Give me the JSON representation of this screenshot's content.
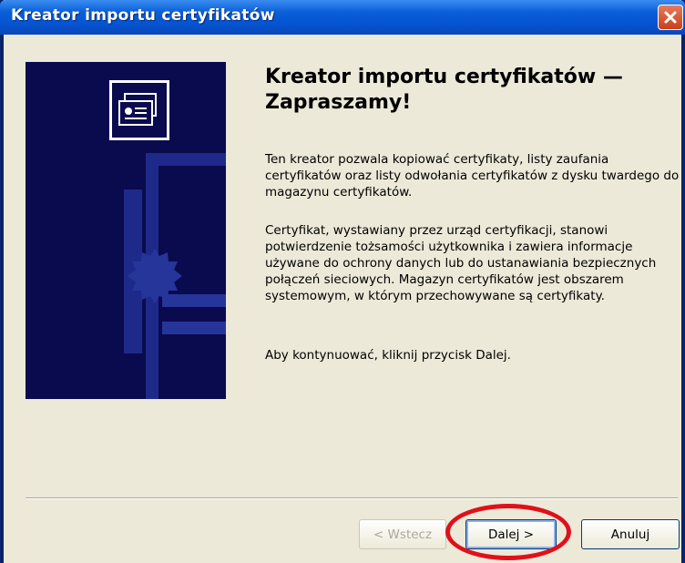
{
  "window": {
    "title": "Kreator importu certyfikatów"
  },
  "content": {
    "heading": "Kreator importu certyfikatów — Zapraszamy!",
    "paragraph1": "Ten kreator pozwala kopiować certyfikaty, listy zaufania certyfikatów oraz listy odwołania certyfikatów z dysku twardego do magazynu certyfikatów.",
    "paragraph2": "Certyfikat, wystawiany przez urząd certyfikacji, stanowi potwierdzenie tożsamości użytkownika i zawiera informacje używane do ochrony danych lub do ustanawiania bezpiecznych połączeń sieciowych. Magazyn certyfikatów jest obszarem systemowym, w którym przechowywane są certyfikaty.",
    "paragraph3": "Aby kontynuować, kliknij przycisk Dalej."
  },
  "buttons": {
    "back": "< Wstecz",
    "next": "Dalej >",
    "cancel": "Anuluj"
  },
  "colors": {
    "titlebar": "#0553d1",
    "banner": "#0a0a4e",
    "highlight": "#e0101a"
  },
  "icons": {
    "close": "close-icon",
    "banner": "certificate-icon"
  }
}
